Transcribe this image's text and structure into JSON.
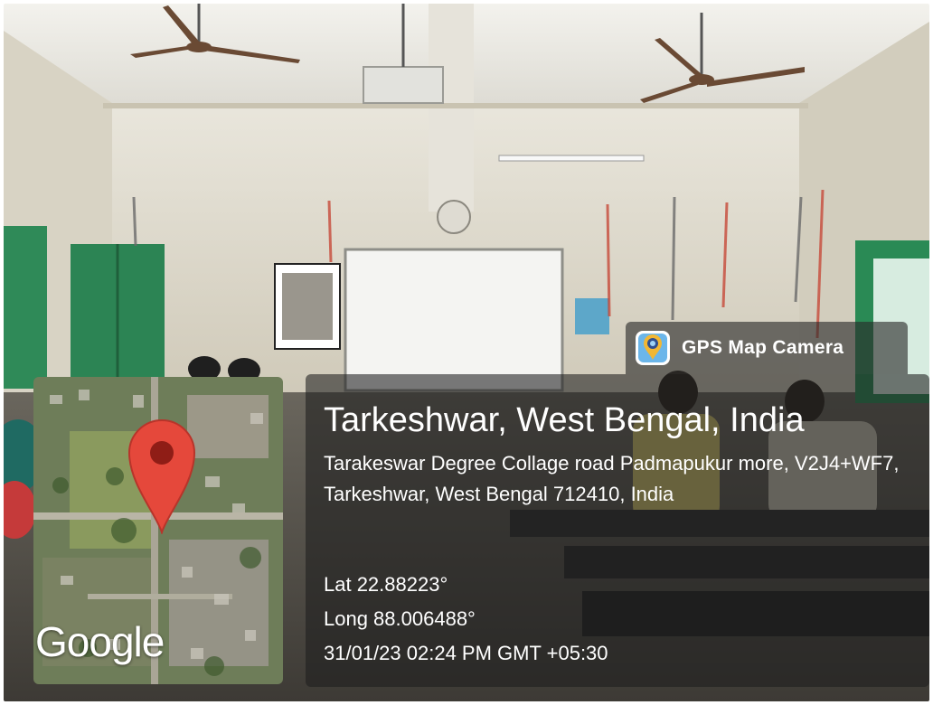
{
  "app": {
    "name": "GPS Map Camera",
    "icon": "gps-camera-icon"
  },
  "map": {
    "provider_logo": "Google",
    "pin_color": "#e5483b",
    "pin_icon": "location-pin-icon"
  },
  "location": {
    "title": "Tarkeshwar, West Bengal, India",
    "address": "Tarakeswar Degree Collage road Padmapukur more, V2J4+WF7, Tarkeshwar, West Bengal 712410, India",
    "lat": "Lat 22.88223°",
    "long": "Long 88.006488°",
    "datetime": "31/01/23 02:24 PM GMT +05:30"
  },
  "colors": {
    "panel_bg": "#1e1e1e",
    "text": "#ffffff"
  }
}
